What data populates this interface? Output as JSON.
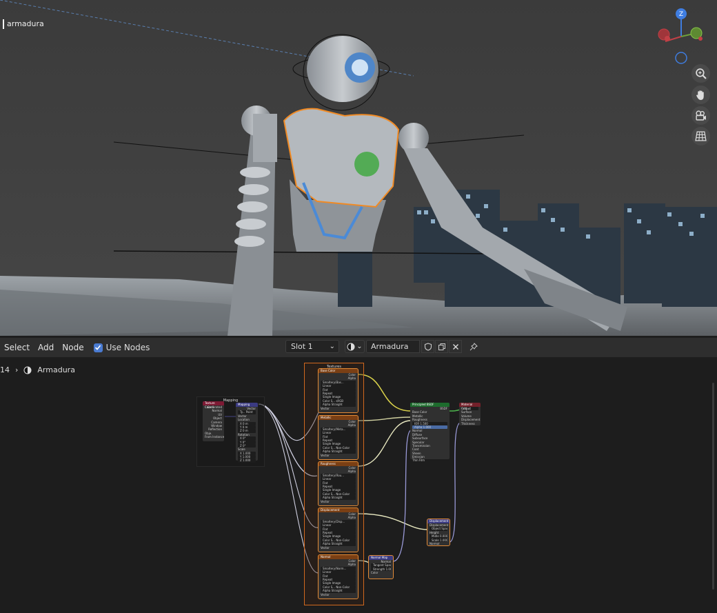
{
  "viewport": {
    "object_label": "armadura",
    "gizmo_axis_z": "Z",
    "tools": [
      {
        "name": "zoom-icon"
      },
      {
        "name": "hand-pan-icon"
      },
      {
        "name": "camera-view-icon"
      },
      {
        "name": "orthographic-grid-icon"
      }
    ]
  },
  "node_header": {
    "menus": [
      "Select",
      "Add",
      "Node"
    ],
    "use_nodes_label": "Use Nodes",
    "use_nodes_checked": true,
    "slot": "Slot 1",
    "material_name": "Armadura",
    "icons": [
      "shield-icon",
      "duplicate-icon",
      "close-icon",
      "pin-icon"
    ]
  },
  "breadcrumb": {
    "prefix": "14",
    "material": "Armadura"
  },
  "nodes": {
    "frame_textures": "Textures",
    "frame_mapping": "Mapping",
    "texcoord": {
      "title": "Texture Coordi.",
      "outputs": [
        "Generated",
        "Normal",
        "UV",
        "Object",
        "Camera",
        "Window",
        "Reflection"
      ],
      "extra": [
        "Obje.",
        "From Instancer"
      ]
    },
    "mapping": {
      "title": "Mapping",
      "rows": [
        "Vector",
        "Ty... Point",
        "Vector",
        "Location",
        "X 0 m",
        "Y 0 m",
        "Z 0 m",
        "Rotation",
        "X 0°",
        "Y 0°",
        "Z 0°",
        "Scale",
        "X 1.000",
        "Y 1.000",
        "Z 1.000"
      ]
    },
    "image_nodes": [
      {
        "title": "Base Color",
        "rows": [
          "Color",
          "Alpha",
          "Smaltery(Bas...",
          "Linear",
          "Flat",
          "Repeat",
          "Single Image",
          "Color S... sRGB",
          "Alpha Straight",
          "Vector"
        ]
      },
      {
        "title": "Metallic",
        "rows": [
          "Color",
          "Alpha",
          "Smaltery(Meta...",
          "Linear",
          "Flat",
          "Repeat",
          "Single Image",
          "Color S... Non-Color",
          "Alpha Straight",
          "Vector"
        ]
      },
      {
        "title": "Roughness",
        "rows": [
          "Color",
          "Alpha",
          "Smaltery(Rou...",
          "Linear",
          "Flat",
          "Repeat",
          "Single Image",
          "Color S... Non-Color",
          "Alpha Straight",
          "Vector"
        ]
      },
      {
        "title": "Displacement",
        "rows": [
          "Color",
          "Alpha",
          "Smaltery(Disp...",
          "Linear",
          "Flat",
          "Repeat",
          "Single Image",
          "Color S... Non-Color",
          "Alpha Straight",
          "Vector"
        ]
      },
      {
        "title": "Normal",
        "rows": [
          "Color",
          "Alpha",
          "Smaltery(Norm...",
          "Linear",
          "Flat",
          "Repeat",
          "Single Image",
          "Color S... Non-Color",
          "Alpha Straight",
          "Vector"
        ]
      }
    ],
    "bsdf": {
      "title": "Principled BSDF",
      "rows": [
        "BSDF",
        "Base Color",
        "Metallic",
        "Roughness",
        "IOR 1.500",
        "Alpha 1.000",
        "Normal",
        "Diffuse",
        "Subsurface",
        "Specular",
        "Transmission",
        "Coat",
        "Sheen",
        "Emission",
        "Thin Film"
      ]
    },
    "output": {
      "title": "Material Output",
      "rows": [
        "All",
        "Surface",
        "Volume",
        "Displacement",
        "Thickness"
      ]
    },
    "normal_map": {
      "title": "Normal Map",
      "rows": [
        "Normal",
        "Tangent Space",
        "Strength 1.000",
        "Color"
      ]
    },
    "displacement": {
      "title": "Displacement",
      "rows": [
        "Displacement",
        "Object Space",
        "Height",
        "Midle 0.000",
        "Scale 1.000",
        "Normal"
      ]
    }
  }
}
